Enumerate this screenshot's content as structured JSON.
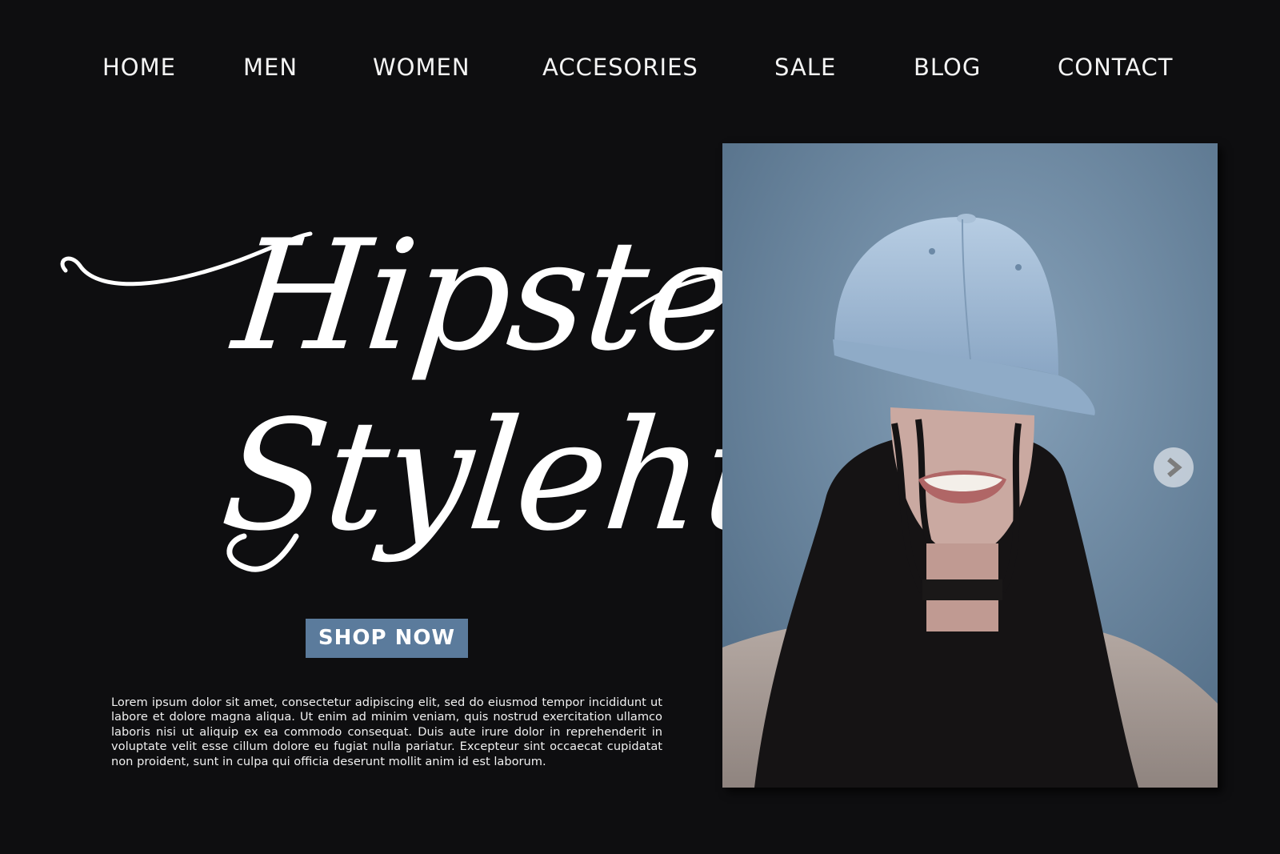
{
  "nav": {
    "items": [
      {
        "label": "HOME"
      },
      {
        "label": "MEN"
      },
      {
        "label": "WOMEN"
      },
      {
        "label": "ACCESORIES"
      },
      {
        "label": "SALE"
      },
      {
        "label": "BLOG"
      },
      {
        "label": "CONTACT"
      }
    ]
  },
  "hero": {
    "title_line1": "Hipster",
    "title_line2": "Stylehub",
    "cta_label": "SHOP NOW",
    "body": "Lorem ipsum dolor sit amet, consectetur adipiscing elit, sed do eiusmod tempor incididunt ut labore et dolore magna aliqua. Ut enim ad minim veniam, quis nostrud exercitation ullamco laboris nisi ut aliquip ex ea commodo consequat. Duis aute irure dolor in reprehenderit in voluptate velit esse cillum dolore eu fugiat nulla pariatur. Excepteur sint occaecat cupidatat non proident, sunt in culpa qui officia deserunt mollit anim id est laborum."
  },
  "carousel": {
    "next_icon": "chevron-right-icon"
  },
  "colors": {
    "background": "#0e0e10",
    "accent": "#5b7b9c",
    "text": "#ffffff",
    "photo_backdrop": "#6f8aa3"
  }
}
